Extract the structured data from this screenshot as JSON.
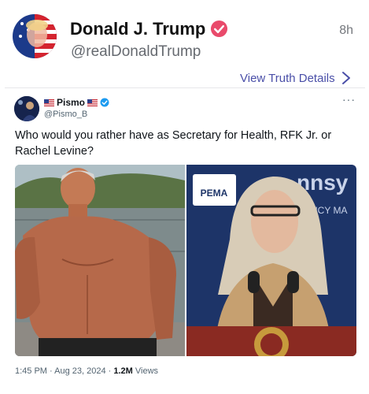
{
  "post": {
    "display_name": "Donald J. Trump",
    "handle": "@realDonaldTrump",
    "time_ago": "8h",
    "view_details": "View Truth Details"
  },
  "quoted": {
    "display_name": "Pismo",
    "handle": "@Pismo_B",
    "more": "···",
    "text": "Who would you rather have as Secretary for Health, RFK Jr. or Rachel Levine?",
    "time": "1:45 PM · Aug 23, 2024 · ",
    "views": "1.2M",
    "views_label": " Views",
    "right_image_sign_1": "nnsy",
    "right_image_sign_2": "ENCY MA",
    "right_image_badge": "PEMA"
  },
  "colors": {
    "link": "#4a4fa8",
    "verified_pink": "#e94a6b",
    "verified_blue": "#1d9bf0"
  },
  "icons": [
    "verified-badge-icon",
    "chevron-right-icon",
    "more-icon",
    "flag-icon"
  ]
}
